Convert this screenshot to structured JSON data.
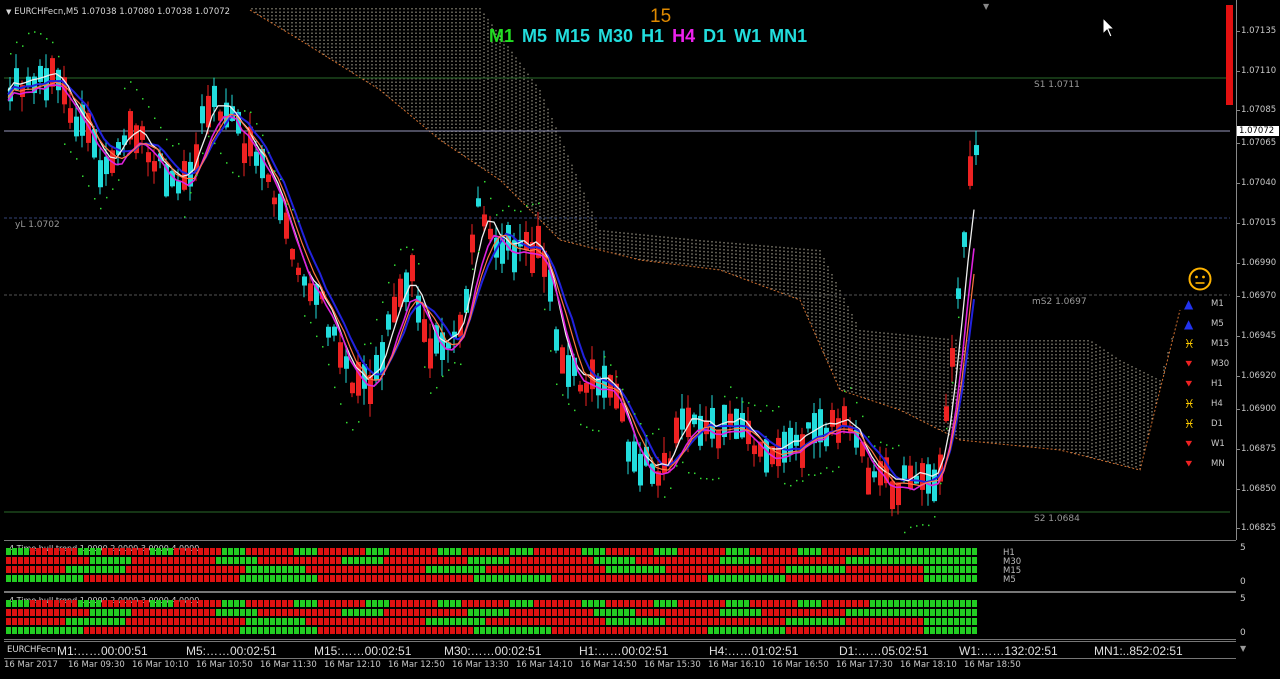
{
  "symbol_header": "EURCHFecn,M5  1.07038 1.07080 1.07038 1.07072",
  "countdown_top": "15",
  "timeframes": [
    {
      "label": "M1",
      "color": "#22dd22"
    },
    {
      "label": "M5",
      "color": "#22dddd"
    },
    {
      "label": "M15",
      "color": "#22dddd"
    },
    {
      "label": "M30",
      "color": "#22dddd"
    },
    {
      "label": "H1",
      "color": "#22dddd"
    },
    {
      "label": "H4",
      "color": "#ee22ee"
    },
    {
      "label": "D1",
      "color": "#22dddd"
    },
    {
      "label": "W1",
      "color": "#22dddd"
    },
    {
      "label": "MN1",
      "color": "#22dddd"
    }
  ],
  "levels": {
    "s1": "S1 1.0711",
    "yl": "yL 1.0702",
    "ms2": "mS2 1.0697",
    "s2": "S2 1.0684"
  },
  "price_axis": [
    "1.07135",
    "1.07110",
    "1.07085",
    "1.07065",
    "1.07040",
    "1.07015",
    "1.06990",
    "1.06970",
    "1.06945",
    "1.06920",
    "1.06900",
    "1.06875",
    "1.06850",
    "1.06825"
  ],
  "current_price": "1.07072",
  "signals": {
    "face": "😐",
    "rows": [
      {
        "tf": "M1",
        "icon": "up-arrow-icon",
        "glyph": "▲",
        "color": "#2233ee"
      },
      {
        "tf": "M5",
        "icon": "up-arrow-icon",
        "glyph": "▲",
        "color": "#2233ee"
      },
      {
        "tf": "M15",
        "icon": "pisces-icon",
        "glyph": "♓",
        "color": "#ffcc00"
      },
      {
        "tf": "M30",
        "icon": "down-arrow-icon",
        "glyph": "⯆",
        "color": "#ee2222"
      },
      {
        "tf": "H1",
        "icon": "down-arrow-icon",
        "glyph": "⯆",
        "color": "#ee2222"
      },
      {
        "tf": "H4",
        "icon": "pisces-icon",
        "glyph": "♓",
        "color": "#ffcc00"
      },
      {
        "tf": "D1",
        "icon": "pisces-icon",
        "glyph": "♓",
        "color": "#ffcc00"
      },
      {
        "tf": "W1",
        "icon": "down-arrow-icon",
        "glyph": "⯆",
        "color": "#ee2222"
      },
      {
        "tf": "MN",
        "icon": "down-arrow-icon",
        "glyph": "⯆",
        "color": "#ee2222"
      }
    ]
  },
  "indicator1": {
    "title": "4 Time hull trend 1.0000 2.0000 3.0000 4.0000",
    "labels": [
      "H1",
      "M30",
      "M15",
      "M5"
    ],
    "axis_top": "5",
    "axis_bottom": "0"
  },
  "indicator2": {
    "title": "4 Time hull trend 1.0000 2.0000 3.0000 4.0000",
    "axis_top": "5",
    "axis_bottom": "0"
  },
  "countdown_bar": {
    "symbol": "EURCHFecn",
    "items": [
      "M1:……00:00:51",
      "M5:……00:02:51",
      "M15:……00:02:51",
      "M30:……00:02:51",
      "H1:……00:02:51",
      "H4:……01:02:51",
      "D1:……05:02:51",
      "W1:……132:02:51",
      "MN1:..852:02:51"
    ]
  },
  "time_axis": [
    "16 Mar 2017",
    "16 Mar 09:30",
    "16 Mar 10:10",
    "16 Mar 10:50",
    "16 Mar 11:30",
    "16 Mar 12:10",
    "16 Mar 12:50",
    "16 Mar 13:30",
    "16 Mar 14:10",
    "16 Mar 14:50",
    "16 Mar 15:30",
    "16 Mar 16:10",
    "16 Mar 16:50",
    "16 Mar 17:30",
    "16 Mar 18:10",
    "16 Mar 18:50"
  ],
  "colors": {
    "bull": "#22dddd",
    "bear": "#ee2222",
    "green": "#22cc22",
    "red": "#dd1111"
  }
}
